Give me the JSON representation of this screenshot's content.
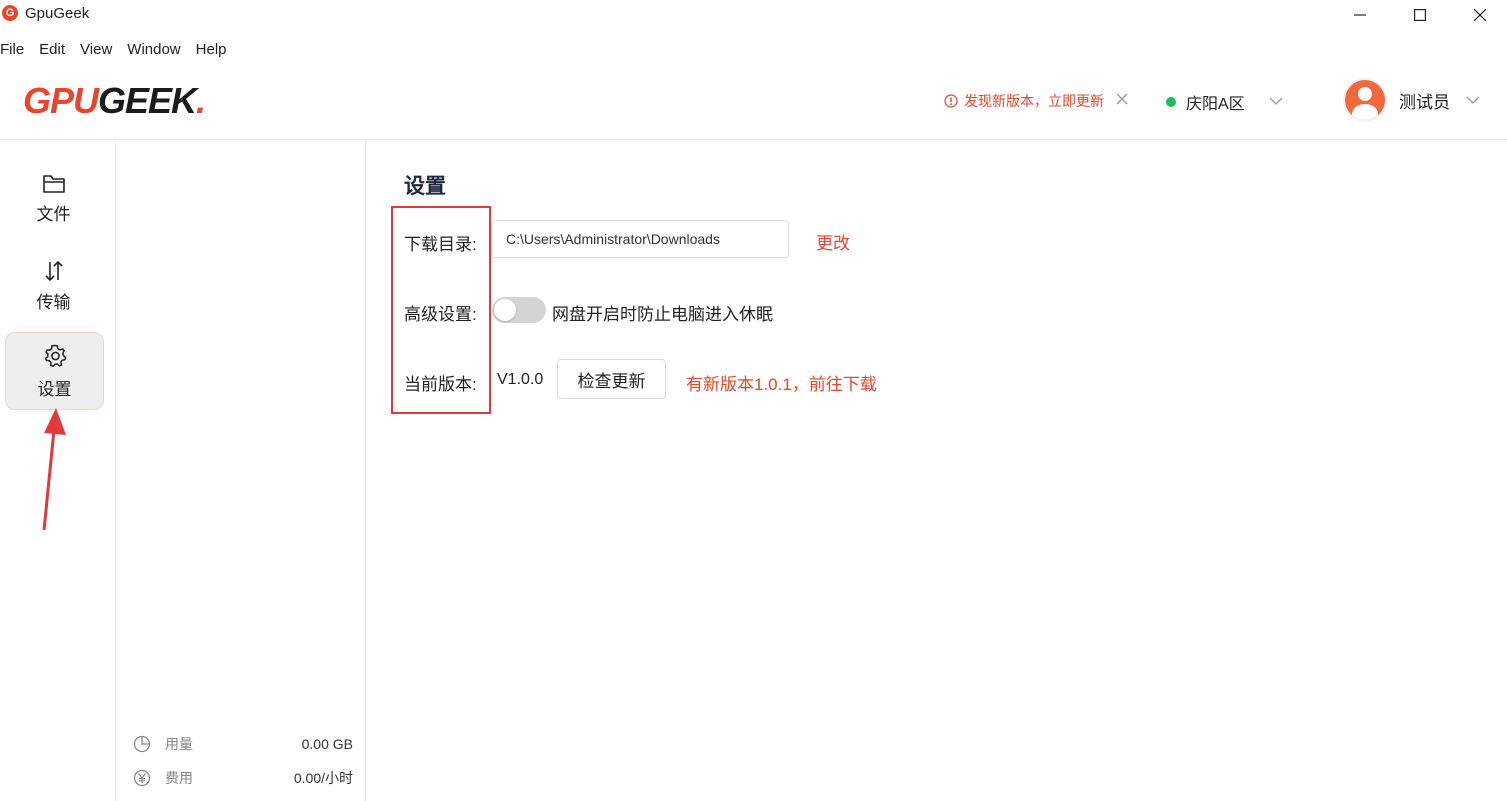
{
  "window": {
    "title": "GpuGeek",
    "icon_letter": "G"
  },
  "menubar": [
    "File",
    "Edit",
    "View",
    "Window",
    "Help"
  ],
  "header": {
    "logo_gpu": "GPU",
    "logo_geek": "GEEK",
    "logo_dot": ".",
    "update_notice": "发现新版本，立即更新",
    "region": "庆阳A区",
    "user_name": "测试员"
  },
  "rail": {
    "files": "文件",
    "transfer": "传输",
    "settings": "设置"
  },
  "stats": {
    "usage_label": "用量",
    "usage_value": "0.00 GB",
    "cost_label": "费用",
    "cost_value": "0.00/小时"
  },
  "settings": {
    "title": "设置",
    "download_dir_label": "下载目录:",
    "download_dir_value": "C:\\Users\\Administrator\\Downloads",
    "change_link": "更改",
    "advanced_label": "高级设置:",
    "prevent_sleep_label": "网盘开启时防止电脑进入休眠",
    "prevent_sleep_enabled": false,
    "version_label": "当前版本:",
    "version_value": "V1.0.0",
    "check_update_button": "检查更新",
    "new_version_notice": "有新版本1.0.1，前往下载"
  },
  "colors": {
    "accent": "#e8452c",
    "online": "#1fbd5a",
    "annotation": "#e03a3a"
  }
}
